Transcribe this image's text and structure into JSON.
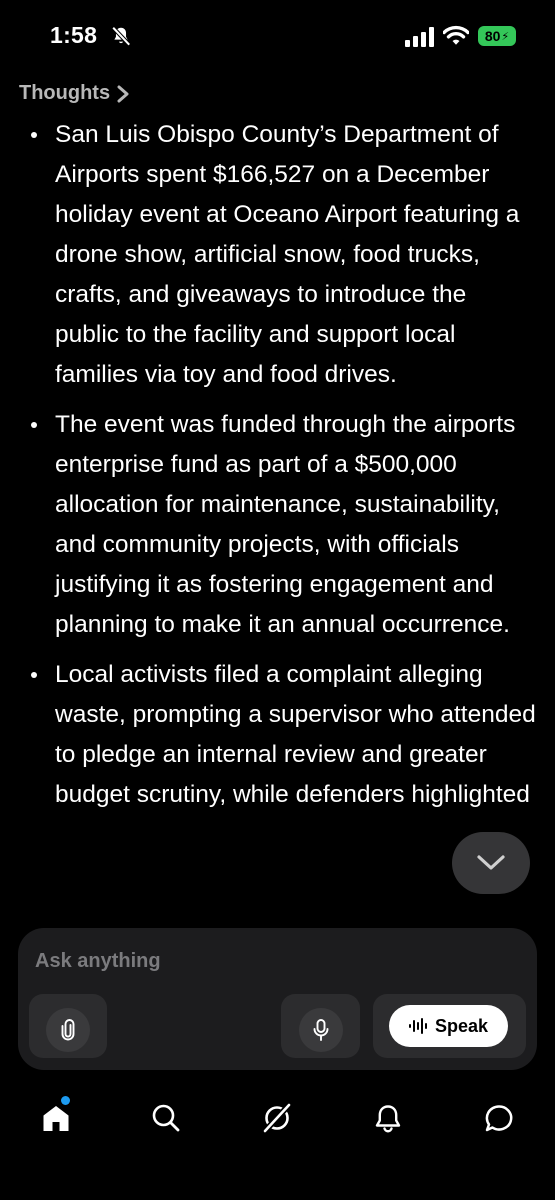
{
  "status_bar": {
    "time": "1:58",
    "battery": "80",
    "icons": [
      "bell-slash-icon",
      "cellular-signal-icon",
      "wifi-icon",
      "battery-charging-icon"
    ],
    "battery_color": "#34c759"
  },
  "thoughts": {
    "label": "Thoughts",
    "icon": "chevron-right-icon"
  },
  "bullets": [
    "San Luis Obispo County’s Department of Airports spent $166,527 on a December holiday event at Oceano Airport featuring a drone show, artificial snow, food trucks, crafts, and giveaways to introduce the public to the facility and support local families via toy and food drives.",
    "The event was funded through the airports enterprise fund as part of a $500,000 allocation for maintenance, sustainability, and community projects, with officials justifying it as fostering engagement and planning to make it an annual occurrence.",
    "Local activists filed a complaint alleging waste, prompting a supervisor who attended to pledge an internal review and greater budget scrutiny, while defenders highlighted"
  ],
  "scroll_button": {
    "icon": "chevron-down-icon"
  },
  "composer": {
    "placeholder": "Ask anything",
    "attach_icon": "paperclip-icon",
    "mic_icon": "microphone-icon",
    "speak_label": "Speak",
    "speak_icon": "waveform-icon"
  },
  "tab_bar": {
    "items": [
      {
        "name": "home",
        "icon": "home-icon",
        "active": true,
        "notification": true
      },
      {
        "name": "search",
        "icon": "search-icon"
      },
      {
        "name": "grok",
        "icon": "grok-icon"
      },
      {
        "name": "notifications",
        "icon": "bell-icon"
      },
      {
        "name": "messages",
        "icon": "chat-bubble-icon"
      }
    ],
    "notification_color": "#1d9bf0"
  }
}
